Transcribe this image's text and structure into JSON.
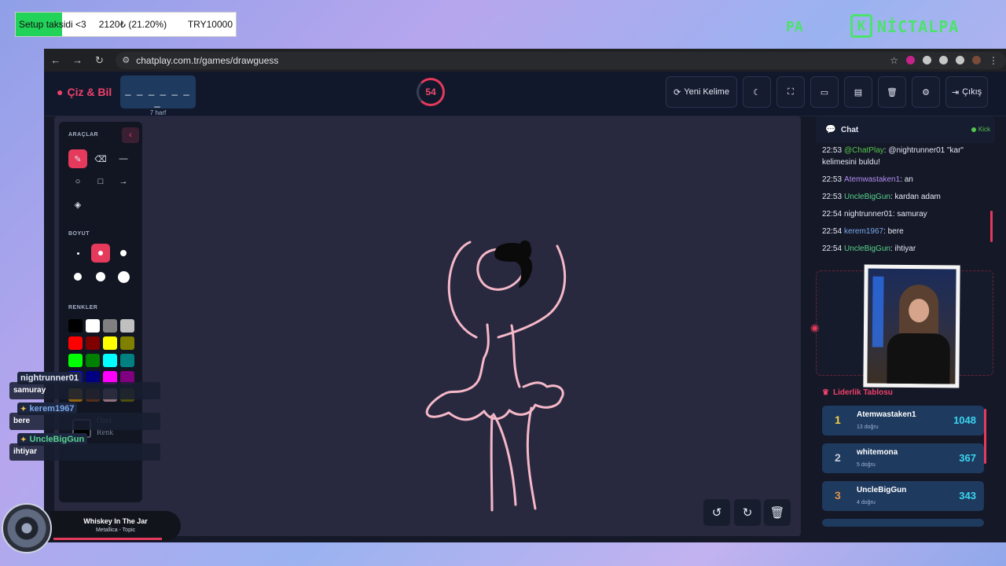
{
  "overlay": {
    "goal": {
      "label": "Setup taksidi <3",
      "amount": "2120₺ (21.20%)",
      "target": "TRY10000",
      "progress": 0.212
    },
    "brand_pa": "PA",
    "brand_logo": "K",
    "brand_name": "NİCTALPA"
  },
  "browser": {
    "url": "chatplay.com.tr/games/drawguess"
  },
  "header": {
    "logo": "Çiz & Bil",
    "word_blanks": "_ _ _ _ _ _ _",
    "word_hint": "7 harf",
    "timer": "54",
    "new_word": "Yeni Kelime",
    "exit": "Çıkış"
  },
  "tools": {
    "tools_title": "ARAÇLAR",
    "size_title": "BOYUT",
    "colors_title": "RENKLER",
    "custom_color": "Özel Renk",
    "colors": [
      "#000000",
      "#ffffff",
      "#808080",
      "#c0c0c0",
      "#ff0000",
      "#800000",
      "#ffff00",
      "#808000",
      "#00ff00",
      "#008000",
      "#00ffff",
      "#008080",
      "#0000ff",
      "#000080",
      "#ff00ff",
      "#800080",
      "#ffa500",
      "#8b4513",
      "#ffc0cb",
      "#808000"
    ]
  },
  "chat": {
    "title": "Chat",
    "platform": "Kick",
    "messages": [
      {
        "time": "22:53",
        "user": "@ChatPlay",
        "text": ": @nightrunner01 \"kar\" kelimesini buldu!"
      },
      {
        "time": "22:53",
        "user": "Atemwastaken1",
        "text": ": an"
      },
      {
        "time": "22:53",
        "user": "UncleBigGun",
        "text": ": kardan adam"
      },
      {
        "time": "22:54",
        "user": "nightrunner01",
        "text": ": samuray"
      },
      {
        "time": "22:54",
        "user": "kerem1967",
        "text": ": bere"
      },
      {
        "time": "22:54",
        "user": "UncleBigGun",
        "text": ": ihtiyar"
      }
    ]
  },
  "leaderboard": {
    "title": "Liderlik Tablosu",
    "rows": [
      {
        "rank": "1",
        "name": "Atemwastaken1",
        "sub": "13 doğru",
        "score": "1048",
        "rank_color": "#f5d142"
      },
      {
        "rank": "2",
        "name": "whitemona",
        "sub": "5 doğru",
        "score": "367",
        "rank_color": "#c5cbd6"
      },
      {
        "rank": "3",
        "name": "UncleBigGun",
        "sub": "4 doğru",
        "score": "343",
        "rank_color": "#e0934a"
      }
    ]
  },
  "stream_chat": [
    {
      "name": "nightrunner01",
      "msg": "samuray"
    },
    {
      "name": "kerem1967",
      "msg": "bere"
    },
    {
      "name": "UncleBigGun",
      "msg": "ihtiyar"
    }
  ],
  "music": {
    "title": "Whiskey In The Jar",
    "artist": "Metallica - Topic"
  }
}
